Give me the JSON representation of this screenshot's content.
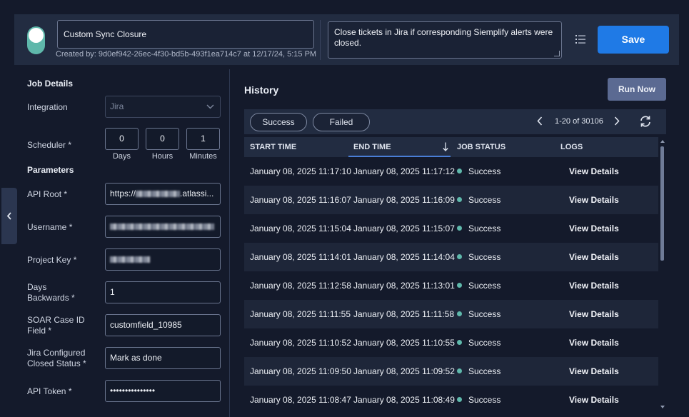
{
  "colors": {
    "background": "#141a2b",
    "panel": "#222c41",
    "accent": "#1f7ae6",
    "run_now": "#5b6a92",
    "toggle_on": "#5fb8ab",
    "status_success": "#5fb8ab"
  },
  "header": {
    "enabled": true,
    "job_name": "Custom Sync Closure",
    "created_by": "Created by: 9d0ef942-26ec-4f30-bd5b-493f1ea714c7 at 12/17/24, 5:15 PM",
    "description": "Close tickets in Jira if corresponding Siemplify alerts were closed.",
    "list_icon": "list-icon",
    "save_label": "Save"
  },
  "job_details": {
    "title": "Job Details",
    "integration": {
      "label": "Integration",
      "value": "Jira"
    },
    "scheduler": {
      "label": "Scheduler *",
      "days": {
        "value": "0",
        "caption": "Days"
      },
      "hours": {
        "value": "0",
        "caption": "Hours"
      },
      "minutes": {
        "value": "1",
        "caption": "Minutes"
      }
    }
  },
  "parameters": {
    "title": "Parameters",
    "api_root": {
      "label": "API Root *",
      "prefix": "https://",
      "suffix": ".atlassi..."
    },
    "username": {
      "label": "Username *"
    },
    "project_key": {
      "label": "Project Key *"
    },
    "days_backwards": {
      "label_line1": "Days",
      "label_line2": "Backwards *",
      "value": "1"
    },
    "soar_case_id_field": {
      "label_line1": "SOAR Case ID",
      "label_line2": "Field *",
      "value": "customfield_10985"
    },
    "jira_closed_status": {
      "label_line1": "Jira Configured",
      "label_line2": "Closed Status *",
      "value": "Mark as done"
    },
    "api_token": {
      "label": "API Token *",
      "value": "•••••••••••••••"
    }
  },
  "history": {
    "title": "History",
    "run_now_label": "Run Now",
    "filters": [
      "Success",
      "Failed"
    ],
    "pagination": "1-20 of 30106",
    "columns": [
      "START TIME",
      "END TIME",
      "JOB STATUS",
      "LOGS"
    ],
    "sorted_column": "END TIME",
    "rows": [
      {
        "start": "January 08, 2025 11:17:10",
        "end": "January 08, 2025 11:17:12",
        "status": "Success",
        "logs": "View Details"
      },
      {
        "start": "January 08, 2025 11:16:07",
        "end": "January 08, 2025 11:16:09",
        "status": "Success",
        "logs": "View Details"
      },
      {
        "start": "January 08, 2025 11:15:04",
        "end": "January 08, 2025 11:15:07",
        "status": "Success",
        "logs": "View Details"
      },
      {
        "start": "January 08, 2025 11:14:01",
        "end": "January 08, 2025 11:14:04",
        "status": "Success",
        "logs": "View Details"
      },
      {
        "start": "January 08, 2025 11:12:58",
        "end": "January 08, 2025 11:13:01",
        "status": "Success",
        "logs": "View Details"
      },
      {
        "start": "January 08, 2025 11:11:55",
        "end": "January 08, 2025 11:11:58",
        "status": "Success",
        "logs": "View Details"
      },
      {
        "start": "January 08, 2025 11:10:52",
        "end": "January 08, 2025 11:10:55",
        "status": "Success",
        "logs": "View Details"
      },
      {
        "start": "January 08, 2025 11:09:50",
        "end": "January 08, 2025 11:09:52",
        "status": "Success",
        "logs": "View Details"
      },
      {
        "start": "January 08, 2025 11:08:47",
        "end": "January 08, 2025 11:08:49",
        "status": "Success",
        "logs": "View Details"
      }
    ]
  }
}
